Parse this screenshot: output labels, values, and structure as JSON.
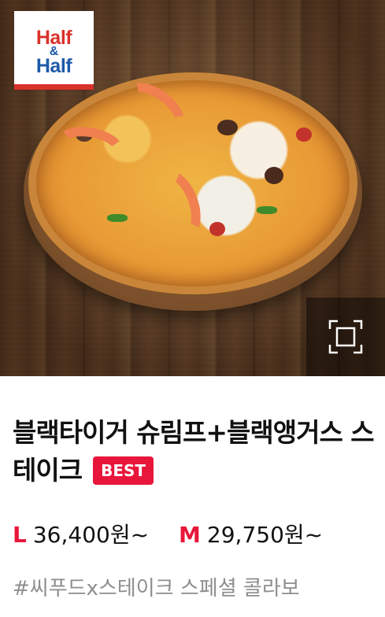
{
  "badge": {
    "line1": "Half",
    "amp": "&",
    "line2": "Half"
  },
  "zoom_icon": "expand-icon",
  "product": {
    "name": "블랙타이거 슈림프+블랙앵거스 스테이크",
    "best_label": "BEST",
    "prices": [
      {
        "size": "L",
        "price": "36,400원~"
      },
      {
        "size": "M",
        "price": "29,750원~"
      }
    ],
    "hashtag": "#씨푸드x스테이크 스페셜 콜라보"
  },
  "colors": {
    "accent": "#e8163a",
    "badge_red": "#d9322b",
    "badge_blue": "#1e5aa8",
    "tag_gray": "#8e8e8e"
  }
}
